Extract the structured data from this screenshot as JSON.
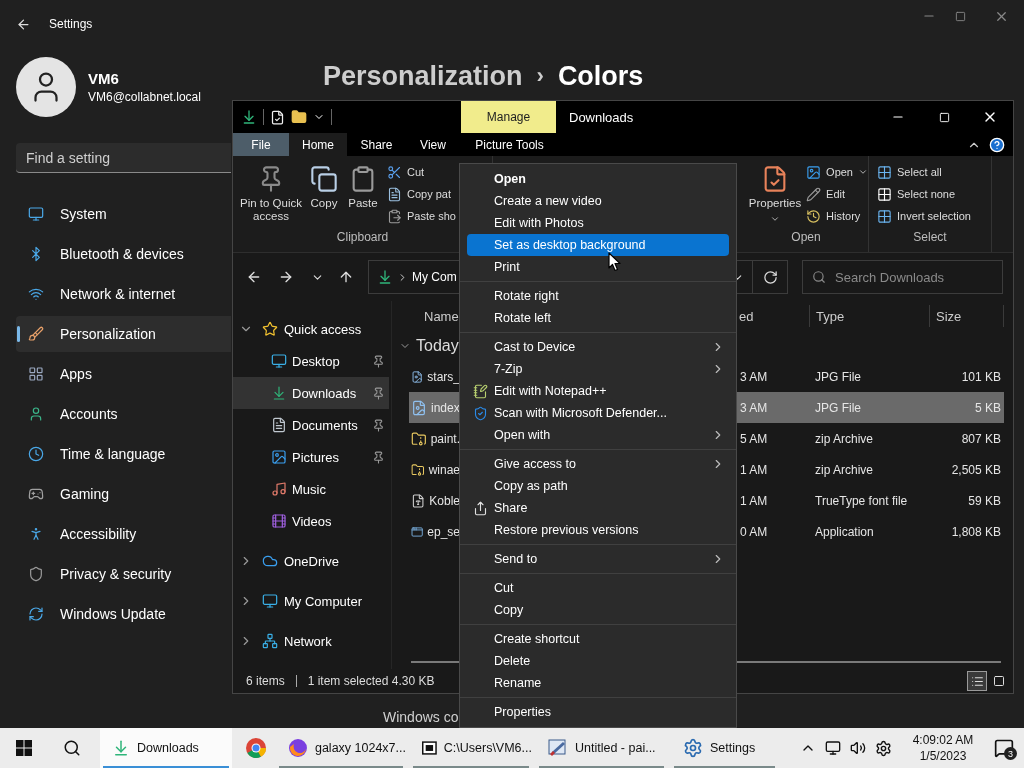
{
  "settings": {
    "title": "Settings",
    "user": {
      "name": "VM6",
      "email": "VM6@collabnet.local"
    },
    "search": {
      "placeholder": "Find a setting"
    },
    "nav": [
      {
        "label": "System",
        "selected": false
      },
      {
        "label": "Bluetooth & devices",
        "selected": false
      },
      {
        "label": "Network & internet",
        "selected": false
      },
      {
        "label": "Personalization",
        "selected": true
      },
      {
        "label": "Apps",
        "selected": false
      },
      {
        "label": "Accounts",
        "selected": false
      },
      {
        "label": "Time & language",
        "selected": false
      },
      {
        "label": "Gaming",
        "selected": false
      },
      {
        "label": "Accessibility",
        "selected": false
      },
      {
        "label": "Privacy & security",
        "selected": false
      },
      {
        "label": "Windows Update",
        "selected": false
      }
    ],
    "breadcrumb": {
      "parent": "Personalization",
      "separator": "›",
      "current": "Colors"
    },
    "section_text": "Windows co"
  },
  "explorer": {
    "title_bar": {
      "context_label": "Manage",
      "title": "Downloads"
    },
    "tabs": [
      {
        "label": "File",
        "kind": "file",
        "selected": false
      },
      {
        "label": "Home",
        "kind": "tab",
        "selected": true
      },
      {
        "label": "Share",
        "kind": "tab",
        "selected": false
      },
      {
        "label": "View",
        "kind": "tab",
        "selected": false
      },
      {
        "label": "Picture Tools",
        "kind": "tab",
        "selected": false
      }
    ],
    "ribbon": [
      {
        "label": "Clipboard",
        "large": [
          {
            "label": "Pin to Quick access",
            "dropdown": false
          },
          {
            "label": "Copy",
            "dropdown": false
          },
          {
            "label": "Paste",
            "dropdown": false
          }
        ],
        "small": [
          {
            "label": "Cut",
            "dropdown": false
          },
          {
            "label": "Copy pat",
            "dropdown": false
          },
          {
            "label": "Paste sho",
            "dropdown": false
          }
        ]
      },
      {
        "label": "Open",
        "large": [
          {
            "label": "Properties",
            "dropdown": true
          }
        ],
        "small": [
          {
            "label": "Open",
            "dropdown": true
          },
          {
            "label": "Edit",
            "dropdown": false
          },
          {
            "label": "History",
            "dropdown": false
          }
        ]
      },
      {
        "label": "Select",
        "small": [
          {
            "label": "Select all",
            "dropdown": false
          },
          {
            "label": "Select none",
            "dropdown": false
          },
          {
            "label": "Invert selection",
            "dropdown": false
          }
        ]
      }
    ],
    "address": {
      "path": "My Com",
      "search_placeholder": "Search Downloads"
    },
    "tree": [
      {
        "label": "Quick access",
        "expanded": true,
        "selected": false,
        "children": [
          {
            "label": "Desktop",
            "pinned": true,
            "selected": false
          },
          {
            "label": "Downloads",
            "pinned": true,
            "selected": true
          },
          {
            "label": "Documents",
            "pinned": true,
            "selected": false
          },
          {
            "label": "Pictures",
            "pinned": true,
            "selected": false
          },
          {
            "label": "Music",
            "pinned": false,
            "selected": false
          },
          {
            "label": "Videos",
            "pinned": false,
            "selected": false
          }
        ]
      },
      {
        "label": "OneDrive",
        "expanded": false,
        "selected": false
      },
      {
        "label": "My Computer",
        "expanded": false,
        "selected": false
      },
      {
        "label": "Network",
        "expanded": false,
        "selected": false
      }
    ],
    "columns": [
      "Name",
      "ed",
      "Type",
      "Size"
    ],
    "group": {
      "label": "Today",
      "expanded": true
    },
    "files": [
      {
        "name": "stars_",
        "date": "3 AM",
        "type": "JPG File",
        "size": "101 KB",
        "kind": "image",
        "selected": false
      },
      {
        "name": "index",
        "date": "3 AM",
        "type": "JPG File",
        "size": "5 KB",
        "kind": "image",
        "selected": true
      },
      {
        "name": "paint.",
        "date": "5 AM",
        "type": "zip Archive",
        "size": "807 KB",
        "kind": "zip",
        "selected": false
      },
      {
        "name": "winae",
        "date": "1 AM",
        "type": "zip Archive",
        "size": "2,505 KB",
        "kind": "zip",
        "selected": false
      },
      {
        "name": "Koble",
        "date": "1 AM",
        "type": "TrueType font file",
        "size": "59 KB",
        "kind": "font",
        "selected": false
      },
      {
        "name": "ep_se",
        "date": "0 AM",
        "type": "Application",
        "size": "1,808 KB",
        "kind": "app",
        "selected": false
      }
    ],
    "status": {
      "count": "6 items",
      "selection": "1 item selected 4.30 KB"
    },
    "view_buttons": [
      {
        "selected": true
      },
      {
        "selected": false
      }
    ]
  },
  "context_menu": {
    "sections": [
      [
        {
          "label": "Open",
          "default": true,
          "selected": false,
          "submenu": false
        },
        {
          "label": "Create a new video",
          "default": false,
          "selected": false,
          "submenu": false
        },
        {
          "label": "Edit with Photos",
          "default": false,
          "selected": false,
          "submenu": false
        },
        {
          "label": "Set as desktop background",
          "default": false,
          "selected": true,
          "submenu": false
        },
        {
          "label": "Print",
          "default": false,
          "selected": false,
          "submenu": false
        }
      ],
      [
        {
          "label": "Rotate right",
          "default": false,
          "selected": false,
          "submenu": false
        },
        {
          "label": "Rotate left",
          "default": false,
          "selected": false,
          "submenu": false
        }
      ],
      [
        {
          "label": "Cast to Device",
          "default": false,
          "selected": false,
          "submenu": true
        },
        {
          "label": "7-Zip",
          "default": false,
          "selected": false,
          "submenu": true
        },
        {
          "label": "Edit with Notepad++",
          "default": false,
          "selected": false,
          "submenu": false
        },
        {
          "label": "Scan with Microsoft Defender...",
          "default": false,
          "selected": false,
          "submenu": false
        },
        {
          "label": "Open with",
          "default": false,
          "selected": false,
          "submenu": true
        }
      ],
      [
        {
          "label": "Give access to",
          "default": false,
          "selected": false,
          "submenu": true
        },
        {
          "label": "Copy as path",
          "default": false,
          "selected": false,
          "submenu": false
        },
        {
          "label": "Share",
          "default": false,
          "selected": false,
          "submenu": false
        },
        {
          "label": "Restore previous versions",
          "default": false,
          "selected": false,
          "submenu": false
        }
      ],
      [
        {
          "label": "Send to",
          "default": false,
          "selected": false,
          "submenu": true
        }
      ],
      [
        {
          "label": "Cut",
          "default": false,
          "selected": false,
          "submenu": false
        },
        {
          "label": "Copy",
          "default": false,
          "selected": false,
          "submenu": false
        }
      ],
      [
        {
          "label": "Create shortcut",
          "default": false,
          "selected": false,
          "submenu": false
        },
        {
          "label": "Delete",
          "default": false,
          "selected": false,
          "submenu": false
        },
        {
          "label": "Rename",
          "default": false,
          "selected": false,
          "submenu": false
        }
      ],
      [
        {
          "label": "Properties",
          "default": false,
          "selected": false,
          "submenu": false
        }
      ]
    ]
  },
  "taskbar": {
    "apps": [
      {
        "label": "Downloads",
        "selected": true,
        "running": true
      },
      {
        "selected": false,
        "running": false
      },
      {
        "label": "galaxy 1024x7...",
        "selected": false,
        "running": true
      },
      {
        "label": "C:\\Users\\VM6...",
        "selected": false,
        "running": true
      },
      {
        "label": "Untitled - pai...",
        "selected": false,
        "running": true
      },
      {
        "label": "Settings",
        "selected": false,
        "running": true
      }
    ],
    "time": "4:09:02 AM",
    "date": "1/5/2023",
    "notifications": "3"
  }
}
